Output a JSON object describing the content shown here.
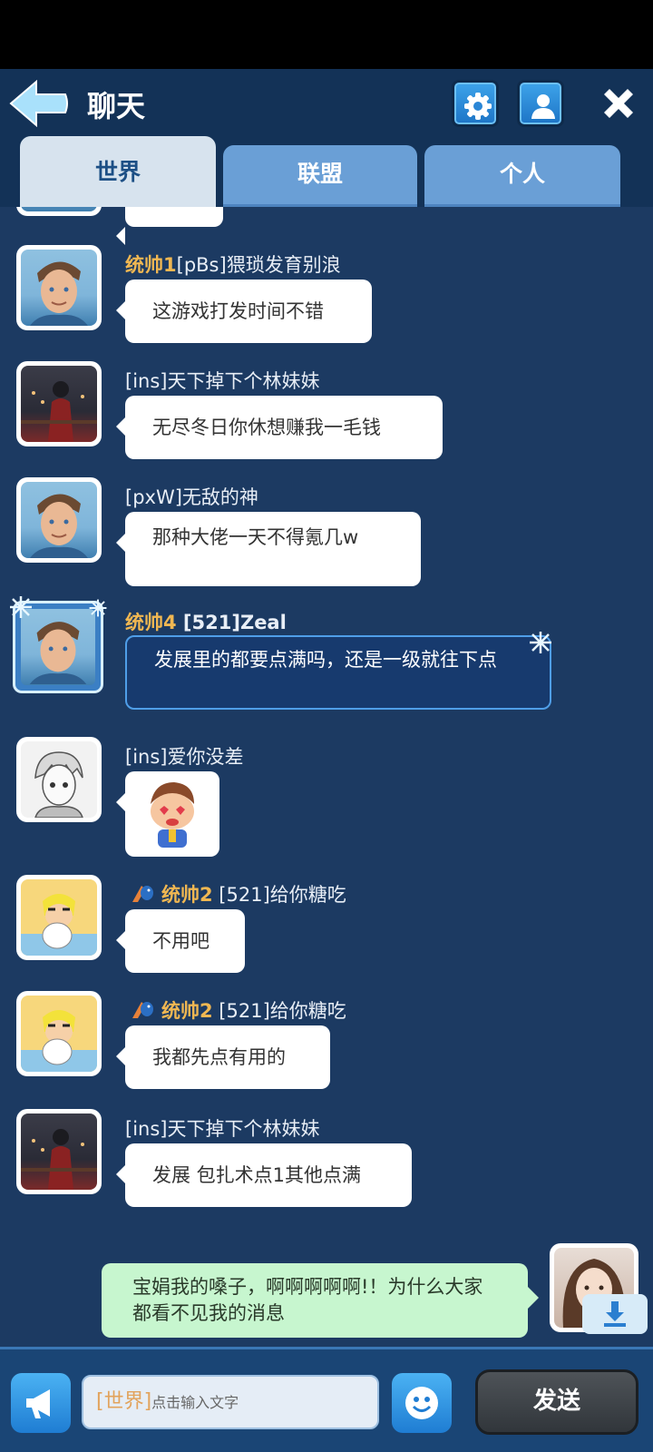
{
  "header": {
    "title": "聊天",
    "icons": [
      "back-arrow-icon",
      "gear-icon",
      "person-icon",
      "close-icon"
    ]
  },
  "tabs": [
    {
      "label": "世界",
      "active": true
    },
    {
      "label": "联盟",
      "active": false
    },
    {
      "label": "个人",
      "active": false
    }
  ],
  "messages": [
    {
      "name_prefix": "统帅1",
      "name_rest": "[pBs]猥琐发育别浪",
      "text": "这游戏打发时间不错"
    },
    {
      "name_prefix": "",
      "name_rest": "[ins]天下掉下个林妹妹",
      "text": "无尽冬日你休想赚我一毛钱"
    },
    {
      "name_prefix": "",
      "name_rest": "[pxW]无敌的神",
      "text": "那种大佬一天不得氪几w"
    },
    {
      "name_prefix": "统帅4",
      "name_rest": " [521]Zeal",
      "text": "发展里的都要点满吗，还是一级就往下点"
    },
    {
      "name_prefix": "",
      "name_rest": "[ins]爱你没差",
      "text": "",
      "sticker": "cartoon-boy-sticker"
    },
    {
      "name_prefix": "统帅2",
      "name_rest": " [521]给你糖吃",
      "text": "不用吧"
    },
    {
      "name_prefix": "统帅2",
      "name_rest": " [521]给你糖吃",
      "text": "我都先点有用的"
    },
    {
      "name_prefix": "",
      "name_rest": "[ins]天下掉下个林妹妹",
      "text": "发展 包扎术点1其他点满"
    }
  ],
  "preview": {
    "text": "宝娟我的嗓子，啊啊啊啊啊!！为什么大家都看不见我的消息"
  },
  "input": {
    "channel_tag": "[世界]",
    "placeholder": "点击输入文字"
  },
  "send_label": "发送",
  "colors": {
    "background": "#1c3a62",
    "header": "#133257",
    "gold_name": "#f0b752",
    "active_tab": "#d7e3ee",
    "inactive_tab": "#6a9fd6"
  }
}
